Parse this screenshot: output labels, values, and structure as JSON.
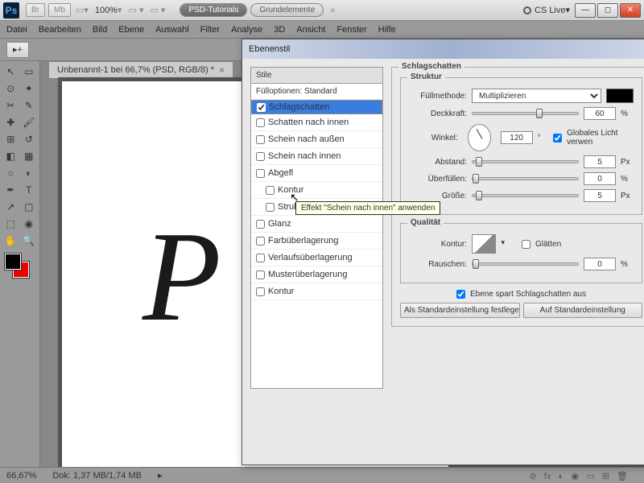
{
  "titlebar": {
    "br": "Br",
    "mb": "Mb",
    "zoom": "100%",
    "tutorials": "PSD-Tutorials",
    "grund": "Grundelemente",
    "cslive": "CS Live"
  },
  "menu": {
    "datei": "Datei",
    "bearbeiten": "Bearbeiten",
    "bild": "Bild",
    "ebene": "Ebene",
    "auswahl": "Auswahl",
    "filter": "Filter",
    "analyse": "Analyse",
    "dd": "3D",
    "ansicht": "Ansicht",
    "fenster": "Fenster",
    "hilfe": "Hilfe"
  },
  "doc": {
    "tab": "Unbenannt-1 bei 66,7% (PSD, RGB/8) *",
    "letter": "P"
  },
  "status": {
    "zoom": "66,67%",
    "dok": "Dok: 1,37 MB/1,74 MB"
  },
  "dialog": {
    "title": "Ebenenstil",
    "stile": "Stile",
    "items": {
      "full": "Fülloptionen: Standard",
      "schlag": "Schlagschatten",
      "innen": "Schatten nach innen",
      "aussen": "Schein nach außen",
      "schein_innen": "Schein nach innen",
      "abgefl": "Abgefl",
      "kontur": "Kontur",
      "struktur": "Struktur",
      "glanz": "Glanz",
      "farb": "Farbüberlagerung",
      "verlauf": "Verlaufsüberlagerung",
      "muster": "Musterüberlagerung",
      "kontur2": "Kontur"
    },
    "group_schlag": "Schlagschatten",
    "group_struktur": "Struktur",
    "fullmethode": "Füllmethode:",
    "fullmethode_v": "Multiplizieren",
    "deckkraft": "Deckkraft:",
    "deckkraft_v": "60",
    "pct": "%",
    "winkel": "Winkel:",
    "winkel_v": "120",
    "deg": "°",
    "global": "Globales Licht verwen",
    "abstand": "Abstand:",
    "abstand_v": "5",
    "px": "Px",
    "uber": "Überfüllen:",
    "uber_v": "0",
    "grosse": "Größe:",
    "grosse_v": "5",
    "group_qual": "Qualität",
    "kontur_l": "Kontur:",
    "glatten": "Glätten",
    "rauschen": "Rauschen:",
    "rauschen_v": "0",
    "spart": "Ebene spart Schlagschatten aus",
    "btn1": "Als Standardeinstellung festlegen",
    "btn2": "Auf Standardeinstellung"
  },
  "tooltip": "Effekt \"Schein nach innen\" anwenden"
}
